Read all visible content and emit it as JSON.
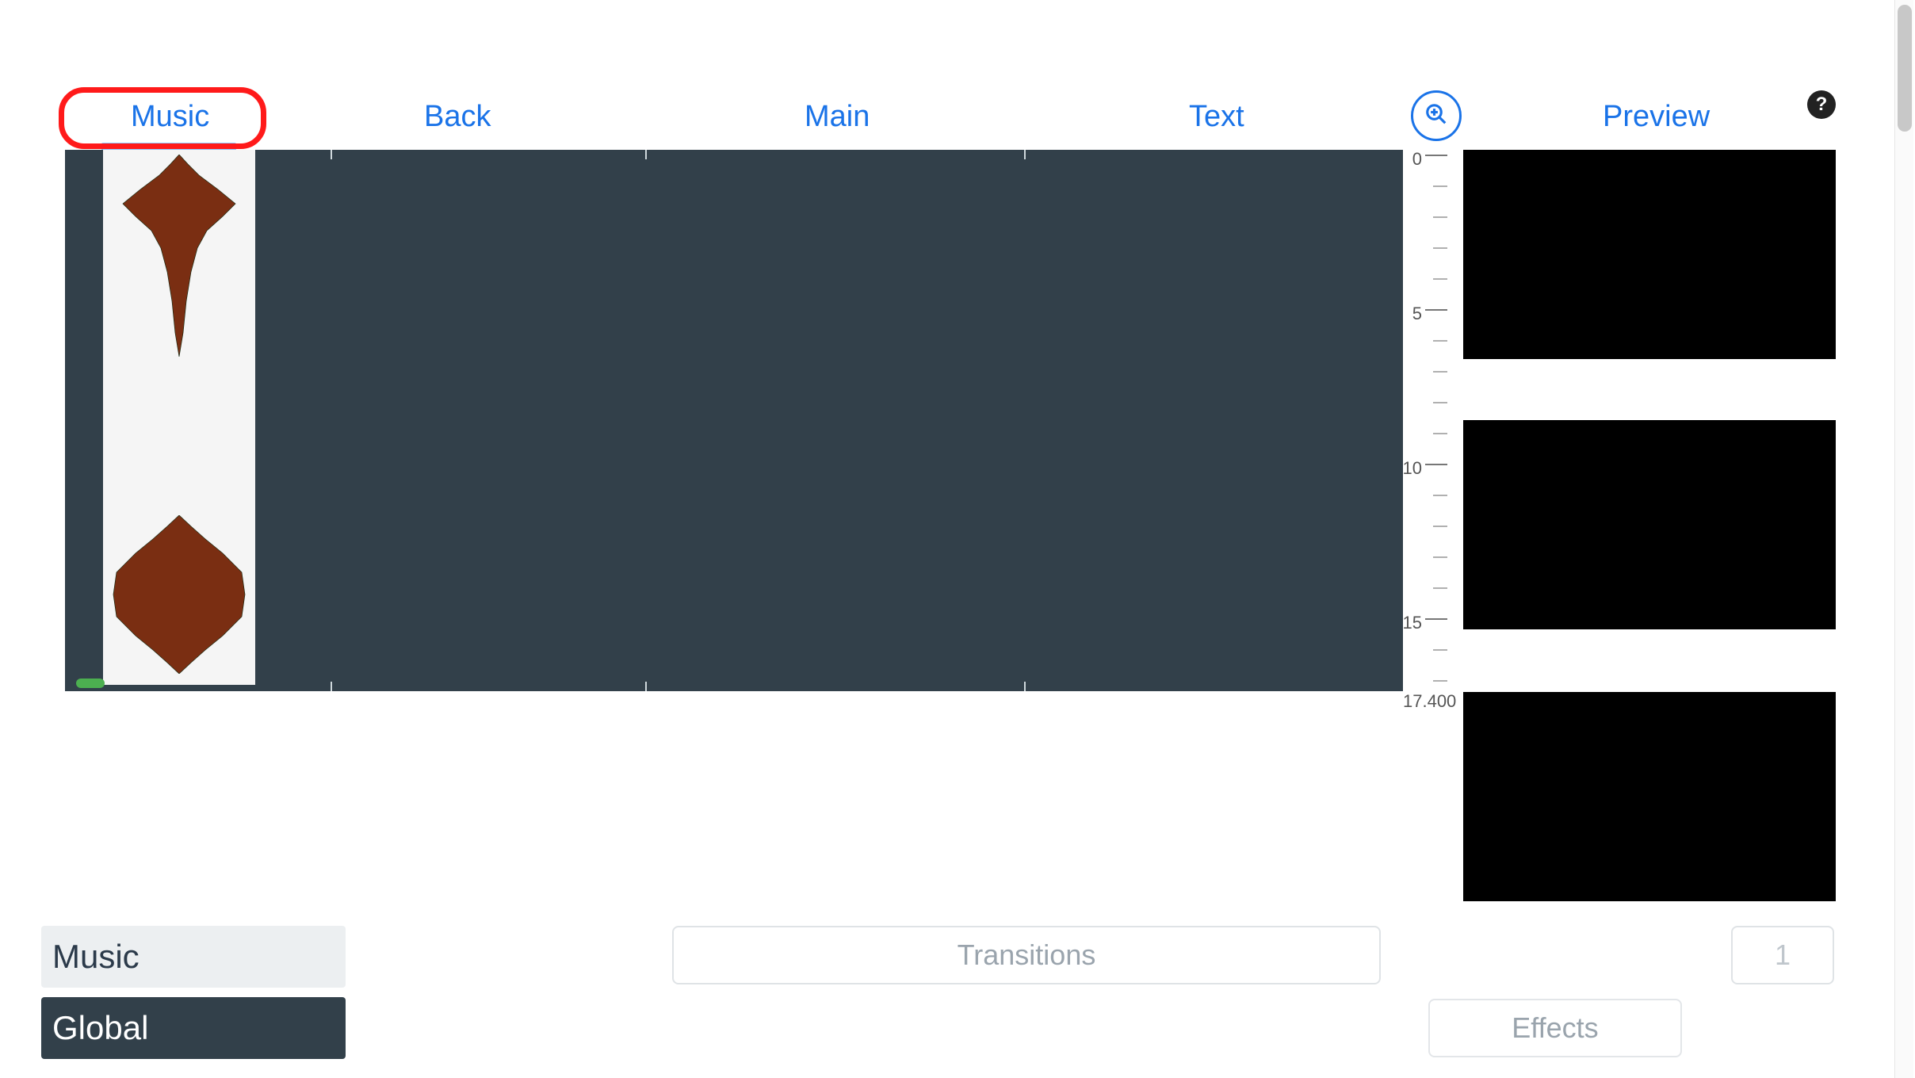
{
  "tabs": {
    "music": "Music",
    "back": "Back",
    "main": "Main",
    "text": "Text",
    "preview": "Preview",
    "active": "Music"
  },
  "timeline": {
    "duration_seconds": 17.4,
    "ruler_labels": {
      "t0": "0",
      "t5": "5",
      "t10": "10",
      "t15": "15"
    },
    "duration_label": "17.400"
  },
  "panels": {
    "a": "Music",
    "b": "Global"
  },
  "buttons": {
    "transitions": "Transitions",
    "effects": "Effects"
  },
  "page_number": "1",
  "icons": {
    "zoom": "zoom-in-icon",
    "help": "?"
  },
  "colors": {
    "accent": "#1a73e8",
    "timeline_bg": "#32404a",
    "highlight_ring": "#ff1a1a"
  }
}
